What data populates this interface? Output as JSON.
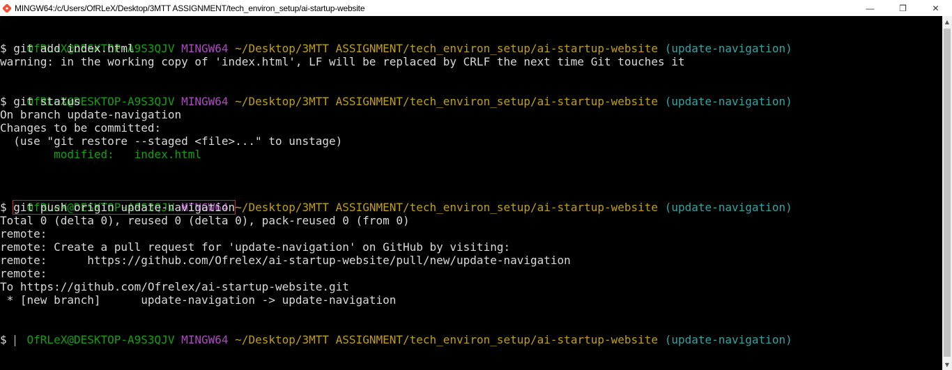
{
  "window": {
    "title": "MINGW64:/c/Users/OfRLeX/Desktop/3MTT ASSIGNMENT/tech_environ_setup/ai-startup-website",
    "minimize_label": "—",
    "maximize_label": "❐",
    "close_label": "✕"
  },
  "prompt": {
    "user_host": "OfRLeX@DESKTOP-A9S3QJV",
    "shell": "MINGW64",
    "path": "~/Desktop/3MTT ASSIGNMENT/tech_environ_setup/ai-startup-website",
    "branch": "(update-navigation)"
  },
  "lines": {
    "cmd1": "$ git add index.html",
    "out1": "warning: in the working copy of 'index.html', LF will be replaced by CRLF the next time Git touches it",
    "cmd2": "$ git status",
    "out2a": "On branch update-navigation",
    "out2b": "Changes to be committed:",
    "out2c": "  (use \"git restore --staged <file>...\" to unstage)",
    "out2d": "        modified:   index.html",
    "cmd3_dollar": "$ ",
    "cmd3": "git push origin update-navigation",
    "out3a": "Total 0 (delta 0), reused 0 (delta 0), pack-reused 0 (from 0)",
    "out3b": "remote:",
    "out3c": "remote: Create a pull request for 'update-navigation' on GitHub by visiting:",
    "out3d": "remote:      https://github.com/Ofrelex/ai-startup-website/pull/new/update-navigation",
    "out3e": "remote:",
    "out3f": "To https://github.com/Ofrelex/ai-startup-website.git",
    "out3g": " * [new branch]      update-navigation -> update-navigation",
    "cmd4": "$ "
  }
}
